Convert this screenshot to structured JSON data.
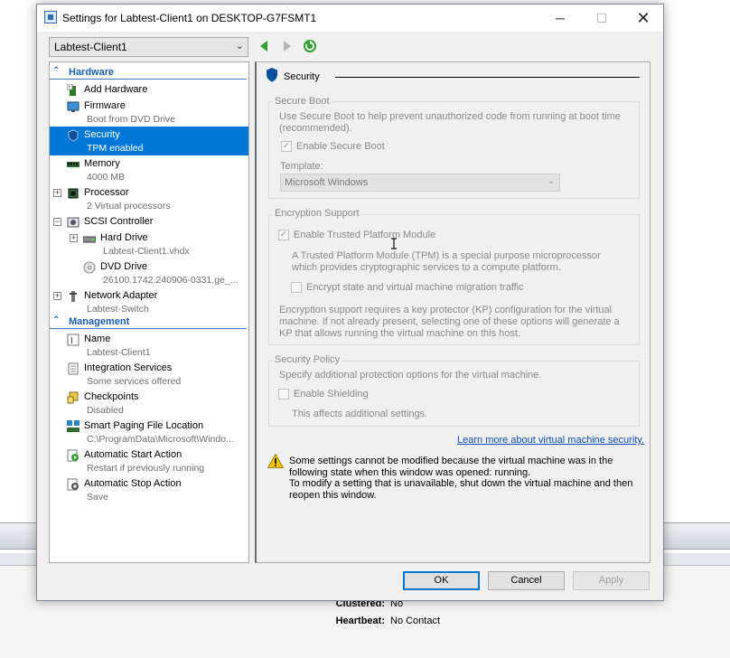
{
  "window": {
    "title": "Settings for Labtest-Client1 on DESKTOP-G7FSMT1",
    "minimize": "─",
    "maximize": "☐",
    "close": "✕"
  },
  "vm_selector": {
    "value": "Labtest-Client1",
    "chevron": "⌄"
  },
  "nav": {
    "back_icon": "green-left-arrow",
    "forward_icon": "gray-right-arrow",
    "refresh_icon": "green-refresh"
  },
  "hardware": {
    "heading": "Hardware",
    "items": [
      {
        "name": "Add Hardware",
        "sub": ""
      },
      {
        "name": "Firmware",
        "sub": "Boot from DVD Drive"
      },
      {
        "name": "Security",
        "sub": "TPM enabled"
      },
      {
        "name": "Memory",
        "sub": "4000 MB"
      },
      {
        "name": "Processor",
        "sub": "2 Virtual processors"
      },
      {
        "name": "SCSI Controller",
        "sub": ""
      },
      {
        "name": "Hard Drive",
        "sub": "Labtest-Client1.vhdx"
      },
      {
        "name": "DVD Drive",
        "sub": "26100.1742.240906-0331.ge_..."
      },
      {
        "name": "Network Adapter",
        "sub": "Labtest-Switch"
      }
    ]
  },
  "management": {
    "heading": "Management",
    "items": [
      {
        "name": "Name",
        "sub": "Labtest-Client1"
      },
      {
        "name": "Integration Services",
        "sub": "Some services offered"
      },
      {
        "name": "Checkpoints",
        "sub": "Disabled"
      },
      {
        "name": "Smart Paging File Location",
        "sub": "C:\\ProgramData\\Microsoft\\Windo..."
      },
      {
        "name": "Automatic Start Action",
        "sub": "Restart if previously running"
      },
      {
        "name": "Automatic Stop Action",
        "sub": "Save"
      }
    ]
  },
  "security": {
    "title": "Security",
    "secure_boot": {
      "label": "Secure Boot",
      "desc": "Use Secure Boot to help prevent unauthorized code from running at boot time (recommended).",
      "enable_label": "Enable Secure Boot",
      "enable_checked": true,
      "template_label": "Template:",
      "template_value": "Microsoft Windows"
    },
    "encryption": {
      "label": "Encryption Support",
      "tpm_label": "Enable Trusted Platform Module",
      "tpm_checked": true,
      "tpm_desc": "A Trusted Platform Module (TPM) is a special purpose microprocessor which provides cryptographic services to a compute platform.",
      "encrypt_label": "Encrypt state and virtual machine migration traffic",
      "encrypt_checked": false,
      "kp_desc": "Encryption support requires a key protector (KP) configuration for the virtual machine. If not already present, selecting one of these options will generate a KP that allows running the virtual machine on this host."
    },
    "policy": {
      "label": "Security Policy",
      "desc": "Specify additional protection options for the virtual machine.",
      "shield_label": "Enable Shielding",
      "shield_checked": false,
      "affects": "This affects additional settings."
    },
    "learn_more": "Learn more about virtual machine security.",
    "warning_line1": "Some settings cannot be modified because the virtual machine was in the following state when this window was opened: running.",
    "warning_line2": "To modify a setting that is unavailable, shut down the virtual machine and then reopen this window."
  },
  "buttons": {
    "ok": "OK",
    "cancel": "Cancel",
    "apply": "Apply"
  },
  "background": {
    "clustered_label": "Clustered:",
    "clustered_value": "No",
    "heartbeat_label": "Heartbeat:",
    "heartbeat_value": "No Contact"
  },
  "colors": {
    "accent": "#0078d7",
    "heading": "#1a5fb4",
    "link": "#0a4fb5"
  }
}
